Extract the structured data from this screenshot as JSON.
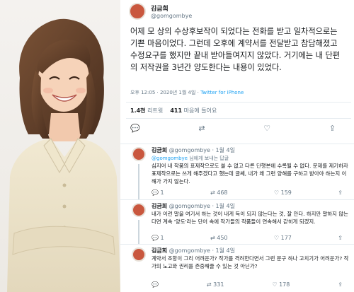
{
  "main_tweet": {
    "display_name": "김금희",
    "handle": "@gomgombye",
    "text": "어제 모 상의 수상후보작이 되었다는 전화를 받고 일차적으로는 기쁜 마음이었다. 그런데 오후에 계약서를 전달받고 참담해졌고 수정요구를 했지만 끝내 받아들여지지 않았다. 거기에는 내 단편의 저작권을 3년간 양도한다는 내용이 있었다.",
    "time": "오후 12:05 · 2020년 1월 4일 · ",
    "source": "Twitter for iPhone",
    "retweets_count": "1.4천",
    "retweets_label": "리트윗",
    "likes_count": "411",
    "likes_label": "마음에 들어요"
  },
  "replies": [
    {
      "display_name": "김금희",
      "handle": "@gomgombye",
      "date": "· 1월 4일",
      "reply_to_prefix": "",
      "reply_to_handle": "@gomgombye",
      "reply_to_suffix": " 님에게 보내는 답글",
      "text": "심지어 내 작품의 표제작으로도 쓸 수 없고 다른 단행본에 수록될 수 없다. 문제를 제기하자 표제작으로는 쓰게 해주겠다고 했는데 글쎄, 내가 왜 그런 양해를 구하고 받아야 하는지 이해가 가지 않는다.",
      "comments": "1",
      "retweets": "468",
      "likes": "159"
    },
    {
      "display_name": "김금희",
      "handle": "@gomgombye",
      "date": "· 1월 4일",
      "text": "내가 이런 말을 여기서 하는 것이 내게 득이 되지 않는다는 것, 잘 안다. 하지만 말하지 않는다면 계속 '양도'라는 단어 속에 작가들의 작품들이 연속해서 갇히게 되겠지.",
      "comments": "1",
      "retweets": "450",
      "likes": "177"
    },
    {
      "display_name": "김금희",
      "handle": "@gomgombye",
      "date": "· 1월 4일",
      "text": "계약서 조항이 그리 어려운가? 작가를 격려한다면서 그런 문구 하나 고치기가 어려운가? 작가의 노고와 권리를 존중해줄 수 있는 것 아닌가?",
      "comments": "",
      "retweets": "331",
      "likes": "178"
    }
  ],
  "icons": {
    "reply": "💬",
    "retweet": "⇄",
    "like": "♡",
    "share": "⇪",
    "caret": "⌄"
  },
  "colors": {
    "accent": "#1da1f2",
    "secondary_text": "#657786",
    "divider": "#e6ecf0"
  }
}
